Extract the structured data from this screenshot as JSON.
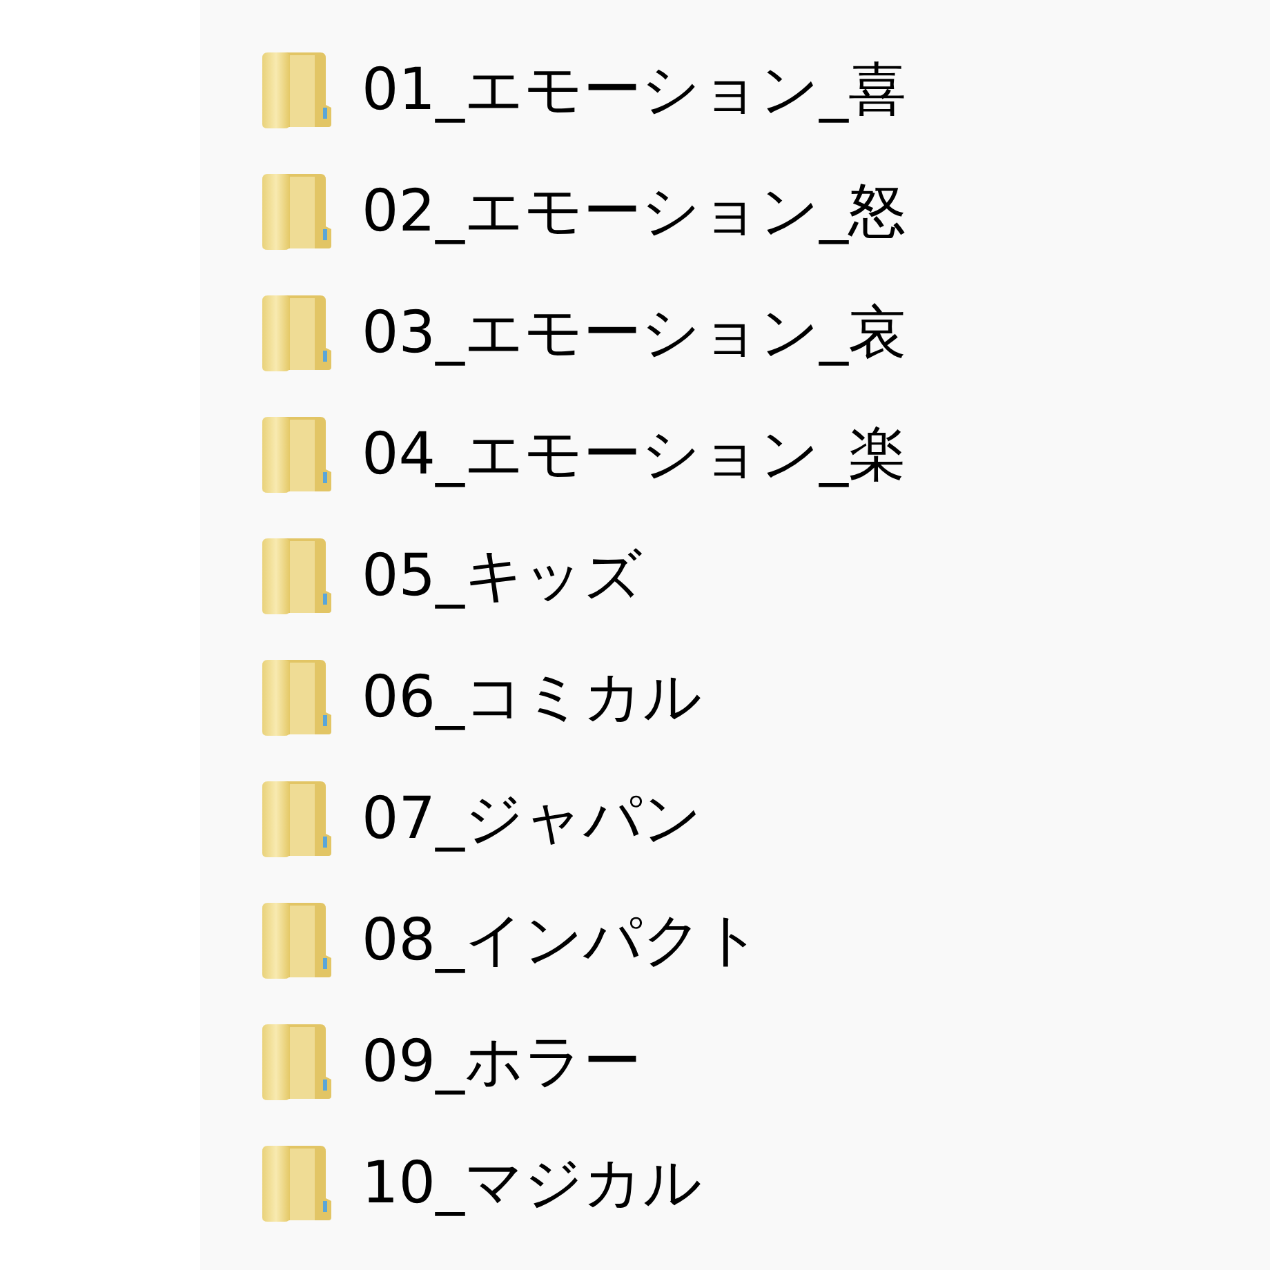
{
  "folders": [
    {
      "name": "01_エモーション_喜"
    },
    {
      "name": "02_エモーション_怒"
    },
    {
      "name": "03_エモーション_哀"
    },
    {
      "name": "04_エモーション_楽"
    },
    {
      "name": "05_キッズ"
    },
    {
      "name": "06_コミカル"
    },
    {
      "name": "07_ジャパン"
    },
    {
      "name": "08_インパクト"
    },
    {
      "name": "09_ホラー"
    },
    {
      "name": "10_マジカル"
    }
  ]
}
